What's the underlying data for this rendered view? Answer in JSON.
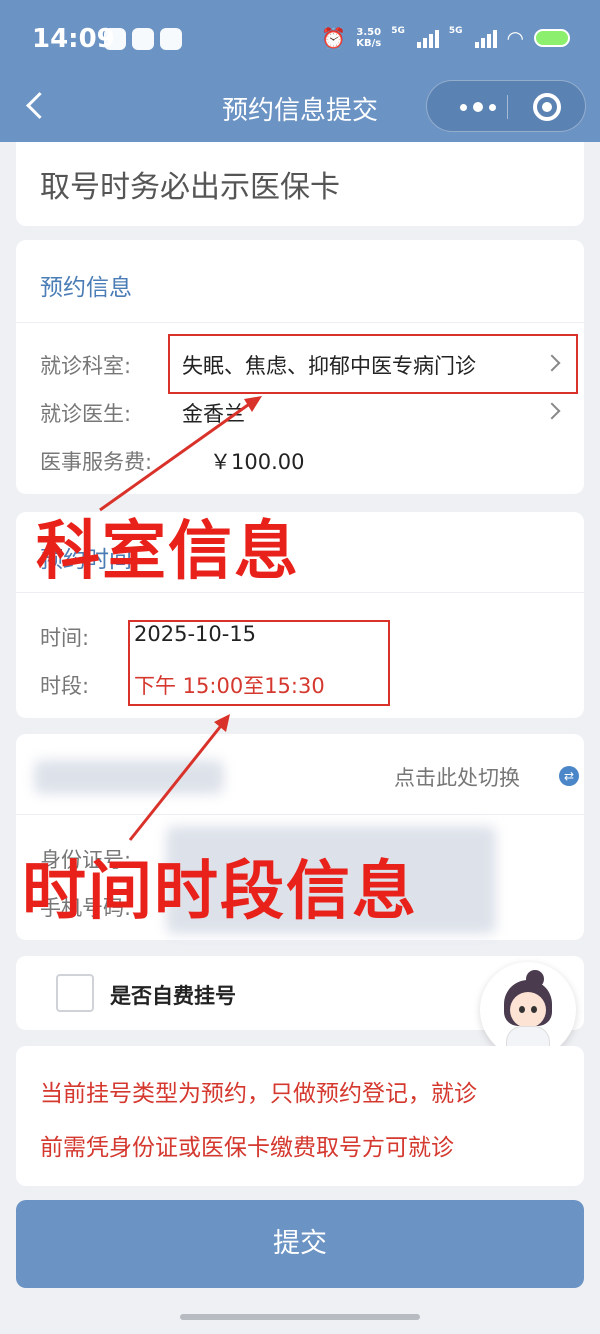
{
  "status_bar": {
    "time": "14:09",
    "net_speed_value": "3.50",
    "net_speed_unit": "KB/s",
    "sim1": "5G",
    "sim2": "5G"
  },
  "nav": {
    "title": "预约信息提交",
    "back_icon": "chevron-left-icon",
    "more_icon": "more-dots-icon",
    "close_icon": "target-close-icon"
  },
  "notice": {
    "text": "取号时务必出示医保卡"
  },
  "appointment": {
    "section_title": "预约信息",
    "rows": [
      {
        "label": "就诊科室:",
        "value": "失眠、焦虑、抑郁中医专病门诊"
      },
      {
        "label": "就诊医生:",
        "value": "金香兰"
      },
      {
        "label": "医事服务费:",
        "value": "￥100.00"
      }
    ]
  },
  "time_section": {
    "section_title": "预约时间",
    "rows": [
      {
        "label": "时间:",
        "value": "2025-10-15"
      },
      {
        "label": "时段:",
        "value": "下午 15:00至15:30"
      }
    ]
  },
  "patient": {
    "switch_label": "点击此处切换",
    "rows": [
      {
        "label": "身份证号:"
      },
      {
        "label": "手机号码:"
      }
    ]
  },
  "self_pay": {
    "label": "是否自费挂号",
    "checked": false
  },
  "warning": {
    "line1": "当前挂号类型为预约，只做预约登记，就诊",
    "line2": "前需凭身份证或医保卡缴费取号方可就诊"
  },
  "submit_label": "提交",
  "annotations": {
    "department_info": "科室信息",
    "time_slot_info": "时间时段信息",
    "color": "#e8221a"
  },
  "colors": {
    "header": "#6b93c4",
    "accent_text": "#4a7cb5",
    "alert": "#d4382e"
  }
}
